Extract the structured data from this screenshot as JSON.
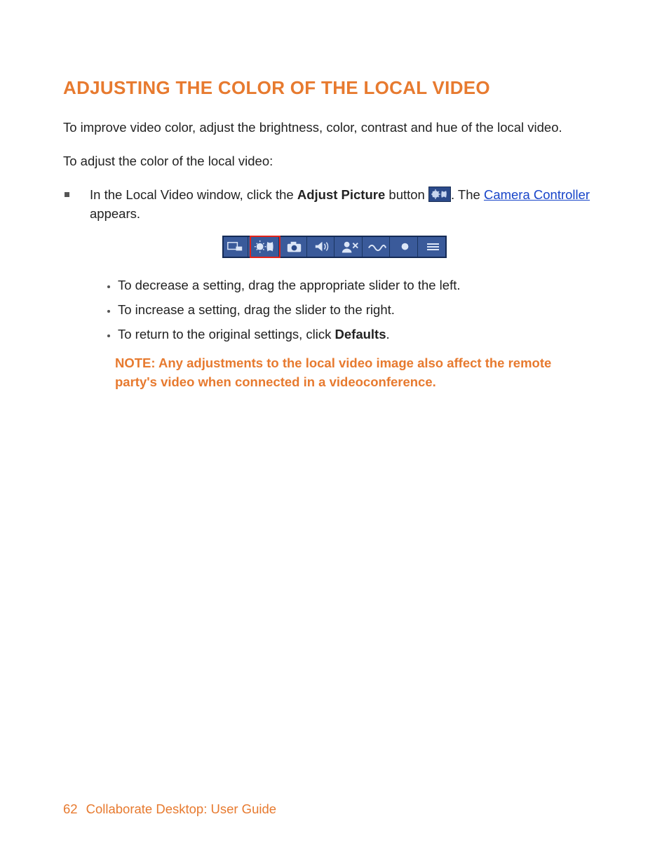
{
  "heading": "ADJUSTING THE COLOR OF THE LOCAL VIDEO",
  "intro1": "To improve video color, adjust the brightness, color, contrast and hue of the local video.",
  "intro2": "To adjust the color of the local video:",
  "step1": {
    "pre": "In the Local Video window, click the ",
    "bold1": "Adjust Picture",
    "mid": " button ",
    "post_icon": ". The ",
    "link": "Camera Controller",
    "tail": " appears."
  },
  "toolbar_icons": [
    "pip-icon",
    "brightness-icon",
    "camera-icon",
    "speaker-icon",
    "user-mute-icon",
    "wave-icon",
    "record-icon",
    "list-icon"
  ],
  "sub1": "To decrease a setting, drag the appropriate slider to the left.",
  "sub2": "To increase a setting, drag the slider to the right.",
  "sub3_pre": "To return to the original settings, click ",
  "sub3_bold": "Defaults",
  "sub3_post": ".",
  "note_label": "NOTE:",
  "note_text": " Any adjustments to the local video image also affect the remote party's video when connected in a videoconference.",
  "footer": {
    "page": "62",
    "title": "Collaborate Desktop: User Guide"
  }
}
